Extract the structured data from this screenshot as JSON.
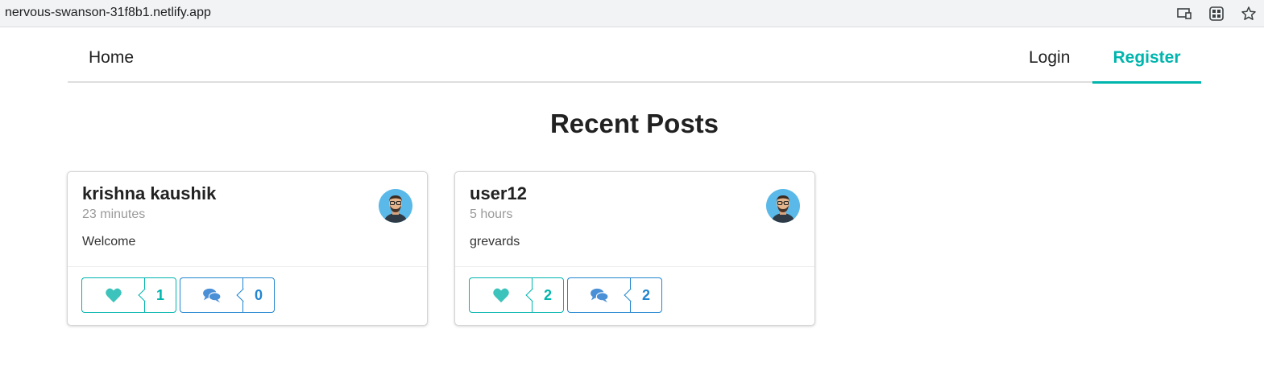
{
  "browser": {
    "url": "nervous-swanson-31f8b1.netlify.app",
    "icons": [
      "cast-icon",
      "qr-code-icon",
      "bookmark-star-icon"
    ]
  },
  "nav": {
    "home": "Home",
    "login": "Login",
    "register": "Register",
    "active": "Register",
    "accent": "#00b5ad"
  },
  "page": {
    "title": "Recent Posts"
  },
  "posts": [
    {
      "username": "krishna kaushik",
      "time": "23 minutes",
      "body": "Welcome",
      "likes": "1",
      "comments": "0"
    },
    {
      "username": "user12",
      "time": "5 hours",
      "body": "grevards",
      "likes": "2",
      "comments": "2"
    }
  ],
  "colors": {
    "like": "#00b5ad",
    "comment": "#2185d0"
  }
}
